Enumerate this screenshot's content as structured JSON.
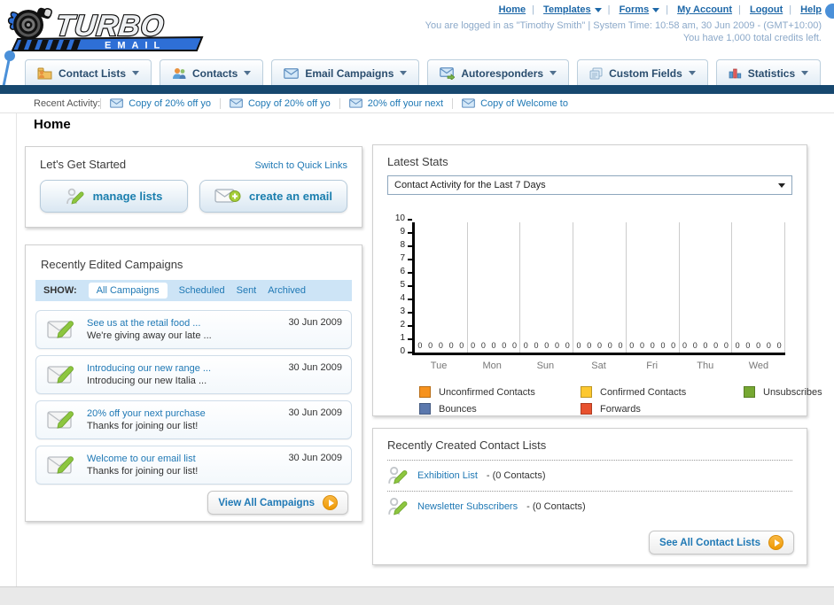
{
  "logo": {
    "title": "TURBO",
    "subtitle": "EMAIL"
  },
  "top_nav": {
    "items": [
      {
        "label": "Home",
        "caret": false
      },
      {
        "label": "Templates",
        "caret": true
      },
      {
        "label": "Forms",
        "caret": true
      },
      {
        "label": "My Account",
        "caret": false
      },
      {
        "label": "Logout",
        "caret": false
      },
      {
        "label": "Help",
        "caret": false
      }
    ]
  },
  "session": {
    "line1": "You are logged in as \"Timothy Smith\" | System Time: 10:58 am, 30 Jun 2009 - (GMT+10:00)",
    "line2": "You have 1,000 total credits left."
  },
  "main_nav": {
    "items": [
      {
        "label": "Contact Lists",
        "icon": "folder-icon"
      },
      {
        "label": "Contacts",
        "icon": "contacts-icon"
      },
      {
        "label": "Email Campaigns",
        "icon": "envelope-icon"
      },
      {
        "label": "Autoresponders",
        "icon": "envelope-arrow-icon"
      },
      {
        "label": "Custom Fields",
        "icon": "pages-icon"
      },
      {
        "label": "Statistics",
        "icon": "bar-chart-icon"
      }
    ]
  },
  "recent_activity": {
    "label": "Recent Activity:",
    "items": [
      "Copy of 20% off yo",
      "Copy of 20% off yo",
      "20% off your next",
      "Copy of Welcome to"
    ]
  },
  "page": {
    "title": "Home"
  },
  "get_started": {
    "title": "Let's Get Started",
    "switch_link": "Switch to Quick Links",
    "buttons": [
      {
        "label": "manage lists"
      },
      {
        "label": "create an email"
      }
    ]
  },
  "campaigns": {
    "title": "Recently Edited Campaigns",
    "show_label": "SHOW:",
    "tabs": [
      "All Campaigns",
      "Scheduled",
      "Sent",
      "Archived"
    ],
    "active_tab": "All Campaigns",
    "items": [
      {
        "title": "See us at the retail food ...",
        "subtitle": "We're giving away our late ...",
        "date": "30 Jun 2009"
      },
      {
        "title": "Introducing our new range ...",
        "subtitle": "Introducing our new Italia ...",
        "date": "30 Jun 2009"
      },
      {
        "title": "20% off your next purchase",
        "subtitle": "Thanks for joining our list!",
        "date": "30 Jun 2009"
      },
      {
        "title": "Welcome to our email list",
        "subtitle": "Thanks for joining our list!",
        "date": "30 Jun 2009"
      }
    ],
    "view_all_label": "View All Campaigns"
  },
  "stats": {
    "title": "Latest Stats",
    "dropdown_value": "Contact Activity for the Last 7 Days"
  },
  "chart_data": {
    "type": "bar",
    "title": "Contact Activity for the Last 7 Days",
    "categories": [
      "Tue",
      "Mon",
      "Sun",
      "Sat",
      "Fri",
      "Thu",
      "Wed"
    ],
    "series": [
      {
        "name": "Unconfirmed Contacts",
        "color": "#f6921e",
        "values": [
          0,
          0,
          0,
          0,
          0,
          0,
          0
        ]
      },
      {
        "name": "Confirmed Contacts",
        "color": "#fdc82f",
        "values": [
          0,
          0,
          0,
          0,
          0,
          0,
          0
        ]
      },
      {
        "name": "Unsubscribes",
        "color": "#76a832",
        "values": [
          0,
          0,
          0,
          0,
          0,
          0,
          0
        ]
      },
      {
        "name": "Bounces",
        "color": "#5b78ad",
        "values": [
          0,
          0,
          0,
          0,
          0,
          0,
          0
        ]
      },
      {
        "name": "Forwards",
        "color": "#e8512e",
        "values": [
          0,
          0,
          0,
          0,
          0,
          0,
          0
        ]
      }
    ],
    "xlabel": "",
    "ylabel": "",
    "ylim": [
      0,
      10
    ],
    "yticks": [
      0,
      1,
      2,
      3,
      4,
      5,
      6,
      7,
      8,
      9,
      10
    ],
    "grid": "vertical-day-separators",
    "legend_position": "bottom",
    "data_labels": "0 shown above baseline for every series/day"
  },
  "contact_lists": {
    "title": "Recently Created Contact Lists",
    "items": [
      {
        "name": "Exhibition List",
        "suffix": "- (0 Contacts)"
      },
      {
        "name": "Newsletter Subscribers",
        "suffix": "- (0 Contacts)"
      }
    ],
    "see_all_label": "See All Contact Lists"
  },
  "icons": {
    "used": [
      "turbo-logo",
      "folder-icon",
      "contacts-icon",
      "envelope-icon",
      "envelope-arrow-icon",
      "pages-icon",
      "bar-chart-icon",
      "pencil-person-icon",
      "envelope-pencil-icon",
      "envelope-plus-icon",
      "orange-arrow-icon",
      "dropdown-caret-icon"
    ]
  },
  "colors": {
    "navy_bar": "#17486f",
    "link_blue": "#2079b5",
    "accent_orange": "#f29a06",
    "show_bar_blue": "#cde4f6",
    "session_text": "#8ca9c9"
  }
}
